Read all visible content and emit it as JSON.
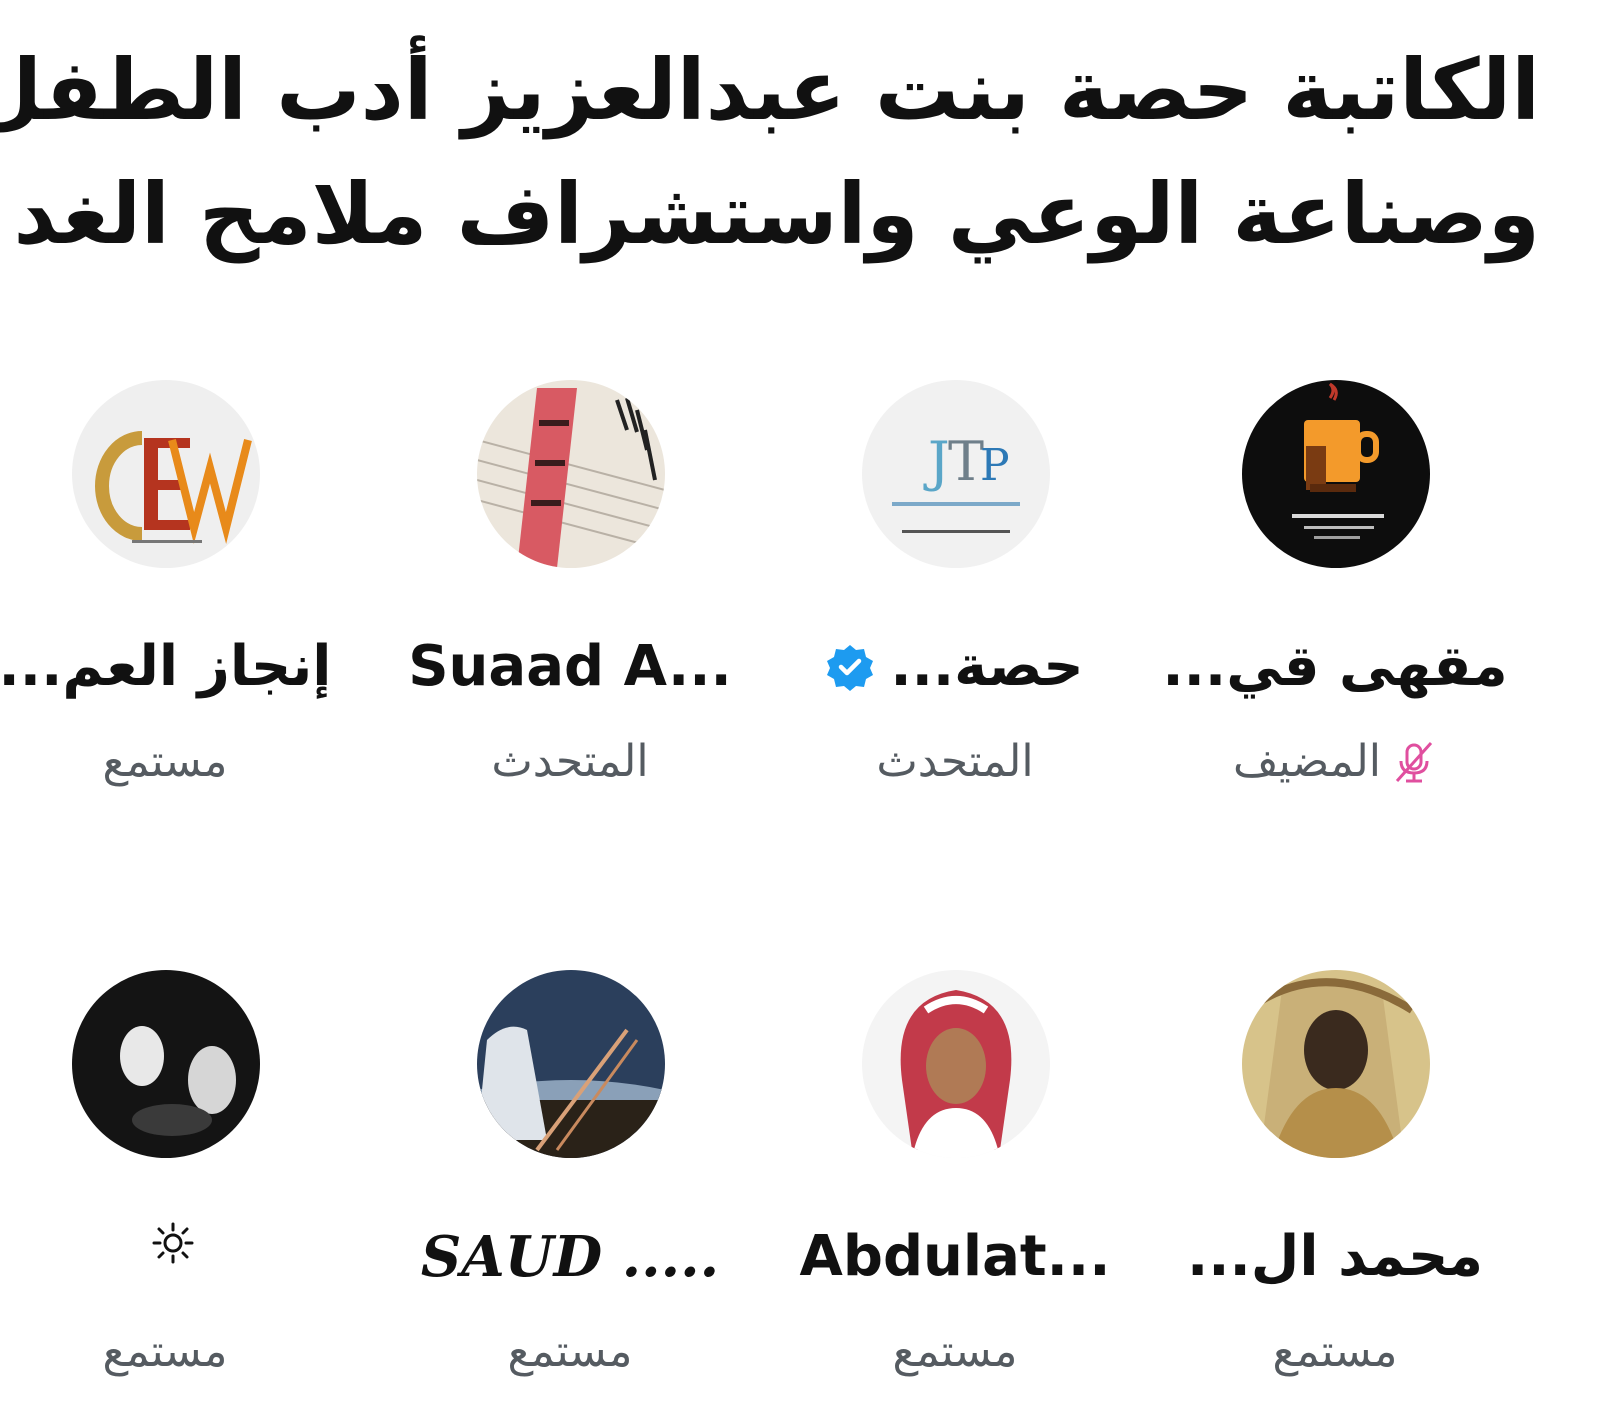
{
  "title": {
    "line1": "الكاتبة حصة بنت عبدالعزيز أدب الطفل",
    "line2": "وصناعة الوعي واستشراف ملامح الغد"
  },
  "row1": [
    {
      "name": "مقهى قي...",
      "role": "المضيف",
      "icon": "mic-off-icon",
      "accent": "#e04f9f"
    },
    {
      "name": "حصة...",
      "role": "المتحدث",
      "icon": "verified-badge-icon",
      "accent": "#1d9bf0"
    },
    {
      "name": "Suaad A...",
      "role": "المتحدث"
    },
    {
      "name": "إنجاز العم...",
      "role": "مستمع"
    }
  ],
  "row2": [
    {
      "name": "محمد ال...",
      "role": "مستمع"
    },
    {
      "name": "Abdulat...",
      "role": "مستمع"
    },
    {
      "name": "SAUD .....",
      "role": "مستمع"
    },
    {
      "name": "",
      "role": "مستمع",
      "icon": "sun-icon"
    }
  ]
}
